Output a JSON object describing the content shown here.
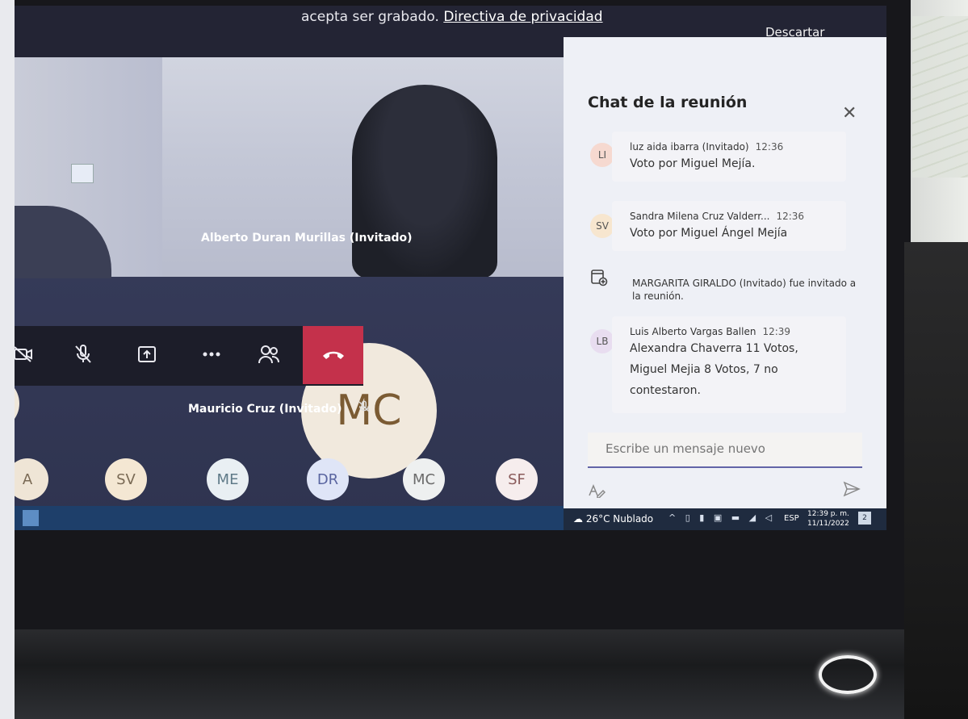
{
  "banner": {
    "text": "acepta ser grabado.",
    "privacy_link": "Directiva de privacidad",
    "discard": "Descartar"
  },
  "video": {
    "main_participant": "Alberto Duran Murillas (Invitado)",
    "featured_initials": "MC",
    "featured_name": "Mauricio Cruz (Invitado)"
  },
  "participants_row": [
    {
      "initials": "A",
      "bg": "#efe5d6",
      "fg": "#7a6a55"
    },
    {
      "initials": "SV",
      "bg": "#f4e7d3",
      "fg": "#7a6a55"
    },
    {
      "initials": "ME",
      "bg": "#e9eff3",
      "fg": "#5f7a88"
    },
    {
      "initials": "DR",
      "bg": "#dfe5f7",
      "fg": "#5a65a0"
    },
    {
      "initials": "MC",
      "bg": "#eef0f0",
      "fg": "#6b6b6b"
    },
    {
      "initials": "SF",
      "bg": "#f6eded",
      "fg": "#8a5b5b"
    }
  ],
  "chat": {
    "title": "Chat de la reunión",
    "messages": [
      {
        "initials": "LI",
        "avatar_bg": "#f6d9d0",
        "sender": "luz aida ibarra (Invitado)",
        "time": "12:36",
        "text": "Voto por  Miguel Mejía."
      },
      {
        "initials": "SV",
        "avatar_bg": "#f7e6cf",
        "sender": "Sandra Milena Cruz Valderr...",
        "time": "12:36",
        "text": "Voto por Miguel Ángel Mejía"
      },
      {
        "initials": "LB",
        "avatar_bg": "#e8ddf0",
        "sender": "Luis Alberto Vargas Ballen",
        "time": "12:39",
        "text": "Alexandra Chaverra 11 Votos, Miguel Mejia 8 Votos, 7 no contestaron."
      }
    ],
    "system_message": "MARGARITA GIRALDO (Invitado) fue invitado a la reunión.",
    "compose_placeholder": "Escribe un mensaje nuevo"
  },
  "tray": {
    "weather": "26°C  Nublado",
    "lang": "ESP",
    "time": "12:39 p. m.",
    "date": "11/11/2022",
    "notifications": "2"
  },
  "colors": {
    "leave_button": "#c4314b",
    "accent": "#6264a7"
  }
}
